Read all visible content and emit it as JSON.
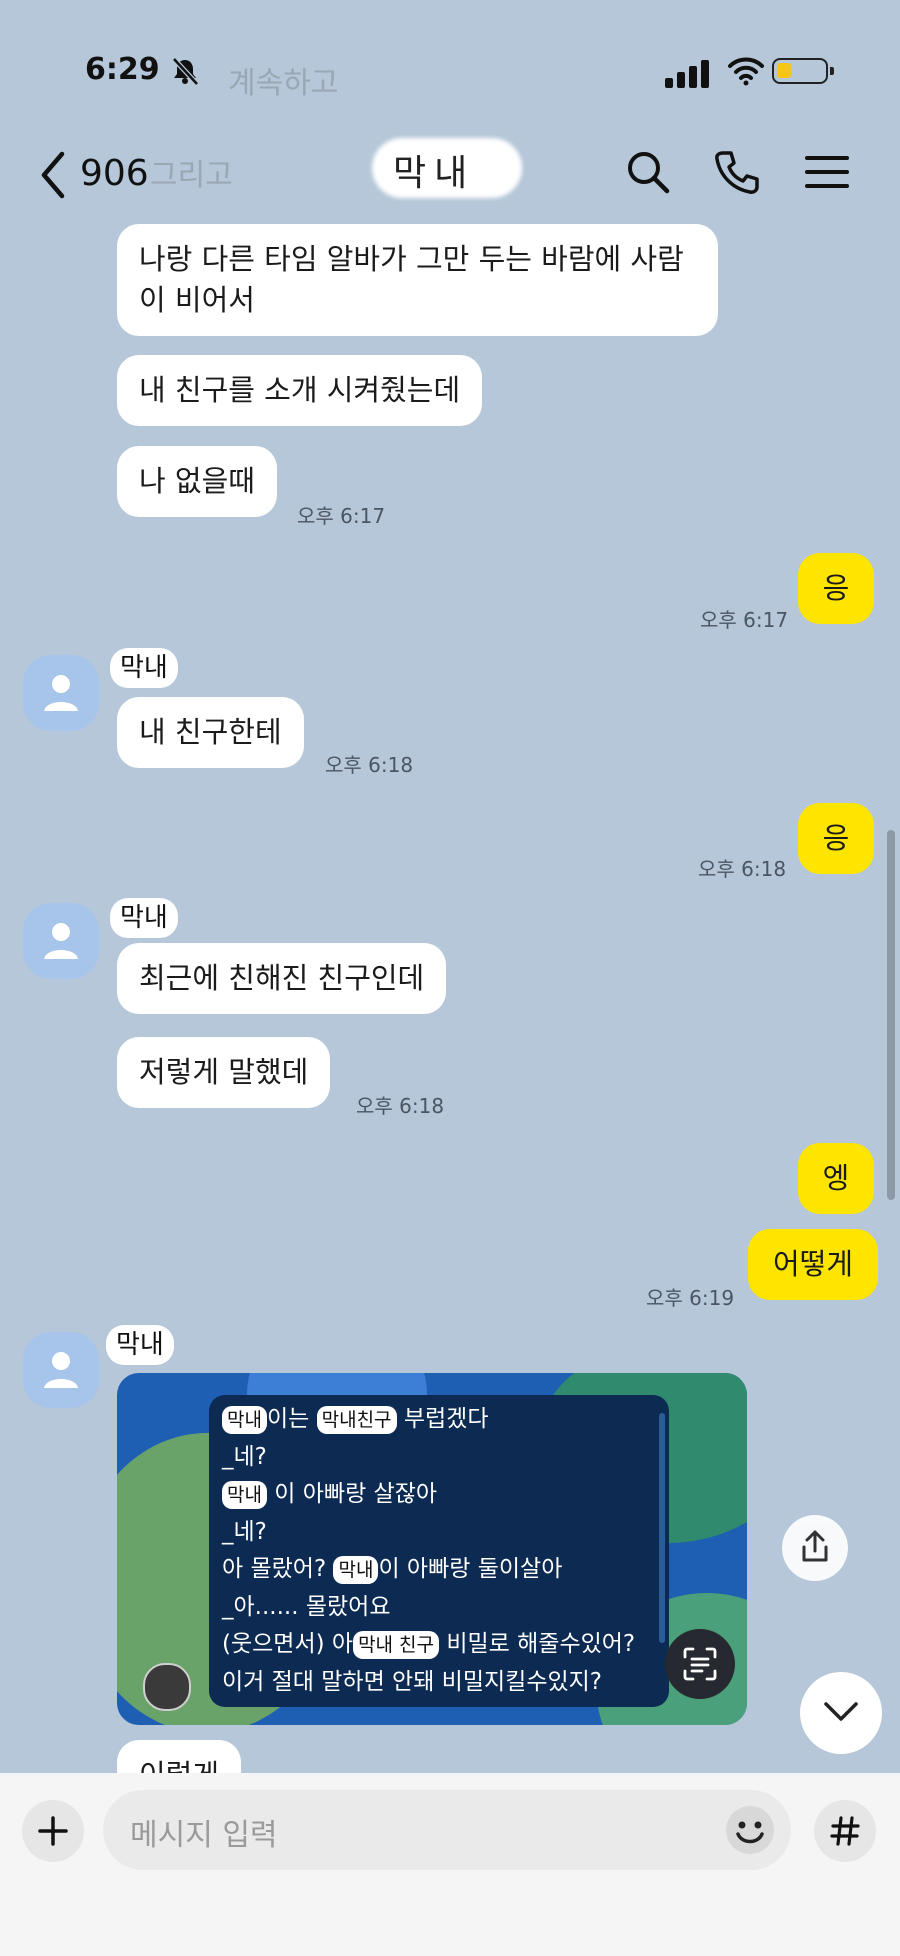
{
  "status_bar": {
    "time": "6:29"
  },
  "header": {
    "back_count": "906",
    "title": "막내"
  },
  "bg_ghost": {
    "line1": "계속하고",
    "line2": "그리고"
  },
  "messages": {
    "m1": "나랑 다른 타임 알바가 그만 두는 바람에 사람이 비어서",
    "m2": "내 친구를 소개 시켜줬는데",
    "m3": "나 없을때",
    "t3": "오후 6:17",
    "m4": "응",
    "t4": "오후 6:17",
    "s5": "막내",
    "m5": "내 친구한테",
    "t5": "오후 6:18",
    "m6": "응",
    "t6": "오후 6:18",
    "s7": "막내",
    "m7": "최근에 친해진 친구인데",
    "m8": "저렇게 말했데",
    "t8": "오후 6:18",
    "m9": "엥",
    "m10": "어떻게",
    "t10": "오후 6:19",
    "s11": "막내",
    "m12": "이렇게"
  },
  "image_card": {
    "l1a": "막내",
    "l1b": "이는",
    "l1c": "막내친구",
    "l1d": "부럽겠다",
    "l2": "_네?",
    "l3a": "막내",
    "l3b": "이 아빠랑 살잖아",
    "l4": "_네?",
    "l5a": "아 몰랐어?",
    "l5b": "막내",
    "l5c": "이 아빠랑 둘이살아",
    "l6": "_아...... 몰랐어요",
    "l7a": "(웃으면서) 아",
    "l7b": "막내 친구",
    "l7c": "비밀로 해줄수있어?",
    "l8": "이거 절대 말하면 안돼 비밀지킬수있지?"
  },
  "input": {
    "placeholder": "메시지 입력"
  },
  "colors": {
    "background": "#b5c7d8",
    "my_bubble": "#fee500",
    "their_bubble": "#ffffff"
  },
  "icons": [
    "back-chevron-icon",
    "search-icon",
    "phone-icon",
    "menu-icon",
    "bell-slash-icon",
    "share-icon",
    "scan-text-icon",
    "chevron-down-icon",
    "plus-icon",
    "emoji-icon",
    "hash-icon",
    "avatar-person-icon"
  ]
}
